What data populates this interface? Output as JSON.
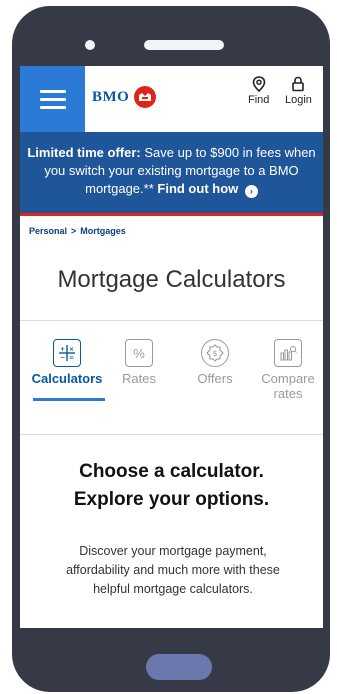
{
  "header": {
    "logo_text": "BMO",
    "find_label": "Find",
    "login_label": "Login"
  },
  "banner": {
    "bold_text": "Limited time offer:",
    "body_text": "Save up to $900 in fees when you switch your existing mortgage to a BMO mortgage.**",
    "link_text": "Find out how"
  },
  "breadcrumb": {
    "items": [
      "Personal",
      "Mortgages"
    ],
    "separator": ">"
  },
  "page_title": "Mortgage Calculators",
  "tabs": [
    {
      "label": "Calculators",
      "icon": "calculator-icon",
      "active": true
    },
    {
      "label": "Rates",
      "icon": "percent-icon",
      "active": false
    },
    {
      "label": "Offers",
      "icon": "offer-badge-icon",
      "active": false
    },
    {
      "label": "Compare rates",
      "icon": "compare-chart-icon",
      "active": false
    }
  ],
  "content": {
    "headline_line1": "Choose a calculator.",
    "headline_line2": "Explore your options.",
    "description": "Discover your mortgage payment, affordability and much more with these helpful mortgage calculators."
  },
  "colors": {
    "brand_blue": "#0a57a4",
    "banner_blue": "#1f5699",
    "menu_blue": "#2b7ad6",
    "brand_red": "#e2231a"
  }
}
